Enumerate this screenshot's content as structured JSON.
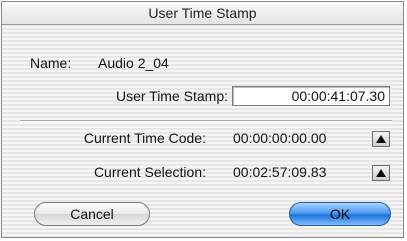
{
  "dialog": {
    "title": "User Time Stamp",
    "name_label": "Name:",
    "name_value": "Audio 2_04",
    "timestamp_label": "User Time Stamp:",
    "timestamp_value": "00:00:41:07.30",
    "current_timecode_label": "Current Time Code:",
    "current_timecode_value": "00:00:00:00.00",
    "current_selection_label": "Current Selection:",
    "current_selection_value": "00:02:57:09.83",
    "cancel_label": "Cancel",
    "ok_label": "OK"
  },
  "icons": {
    "timecode_button": "up-arrow-icon",
    "selection_button": "up-arrow-icon"
  }
}
